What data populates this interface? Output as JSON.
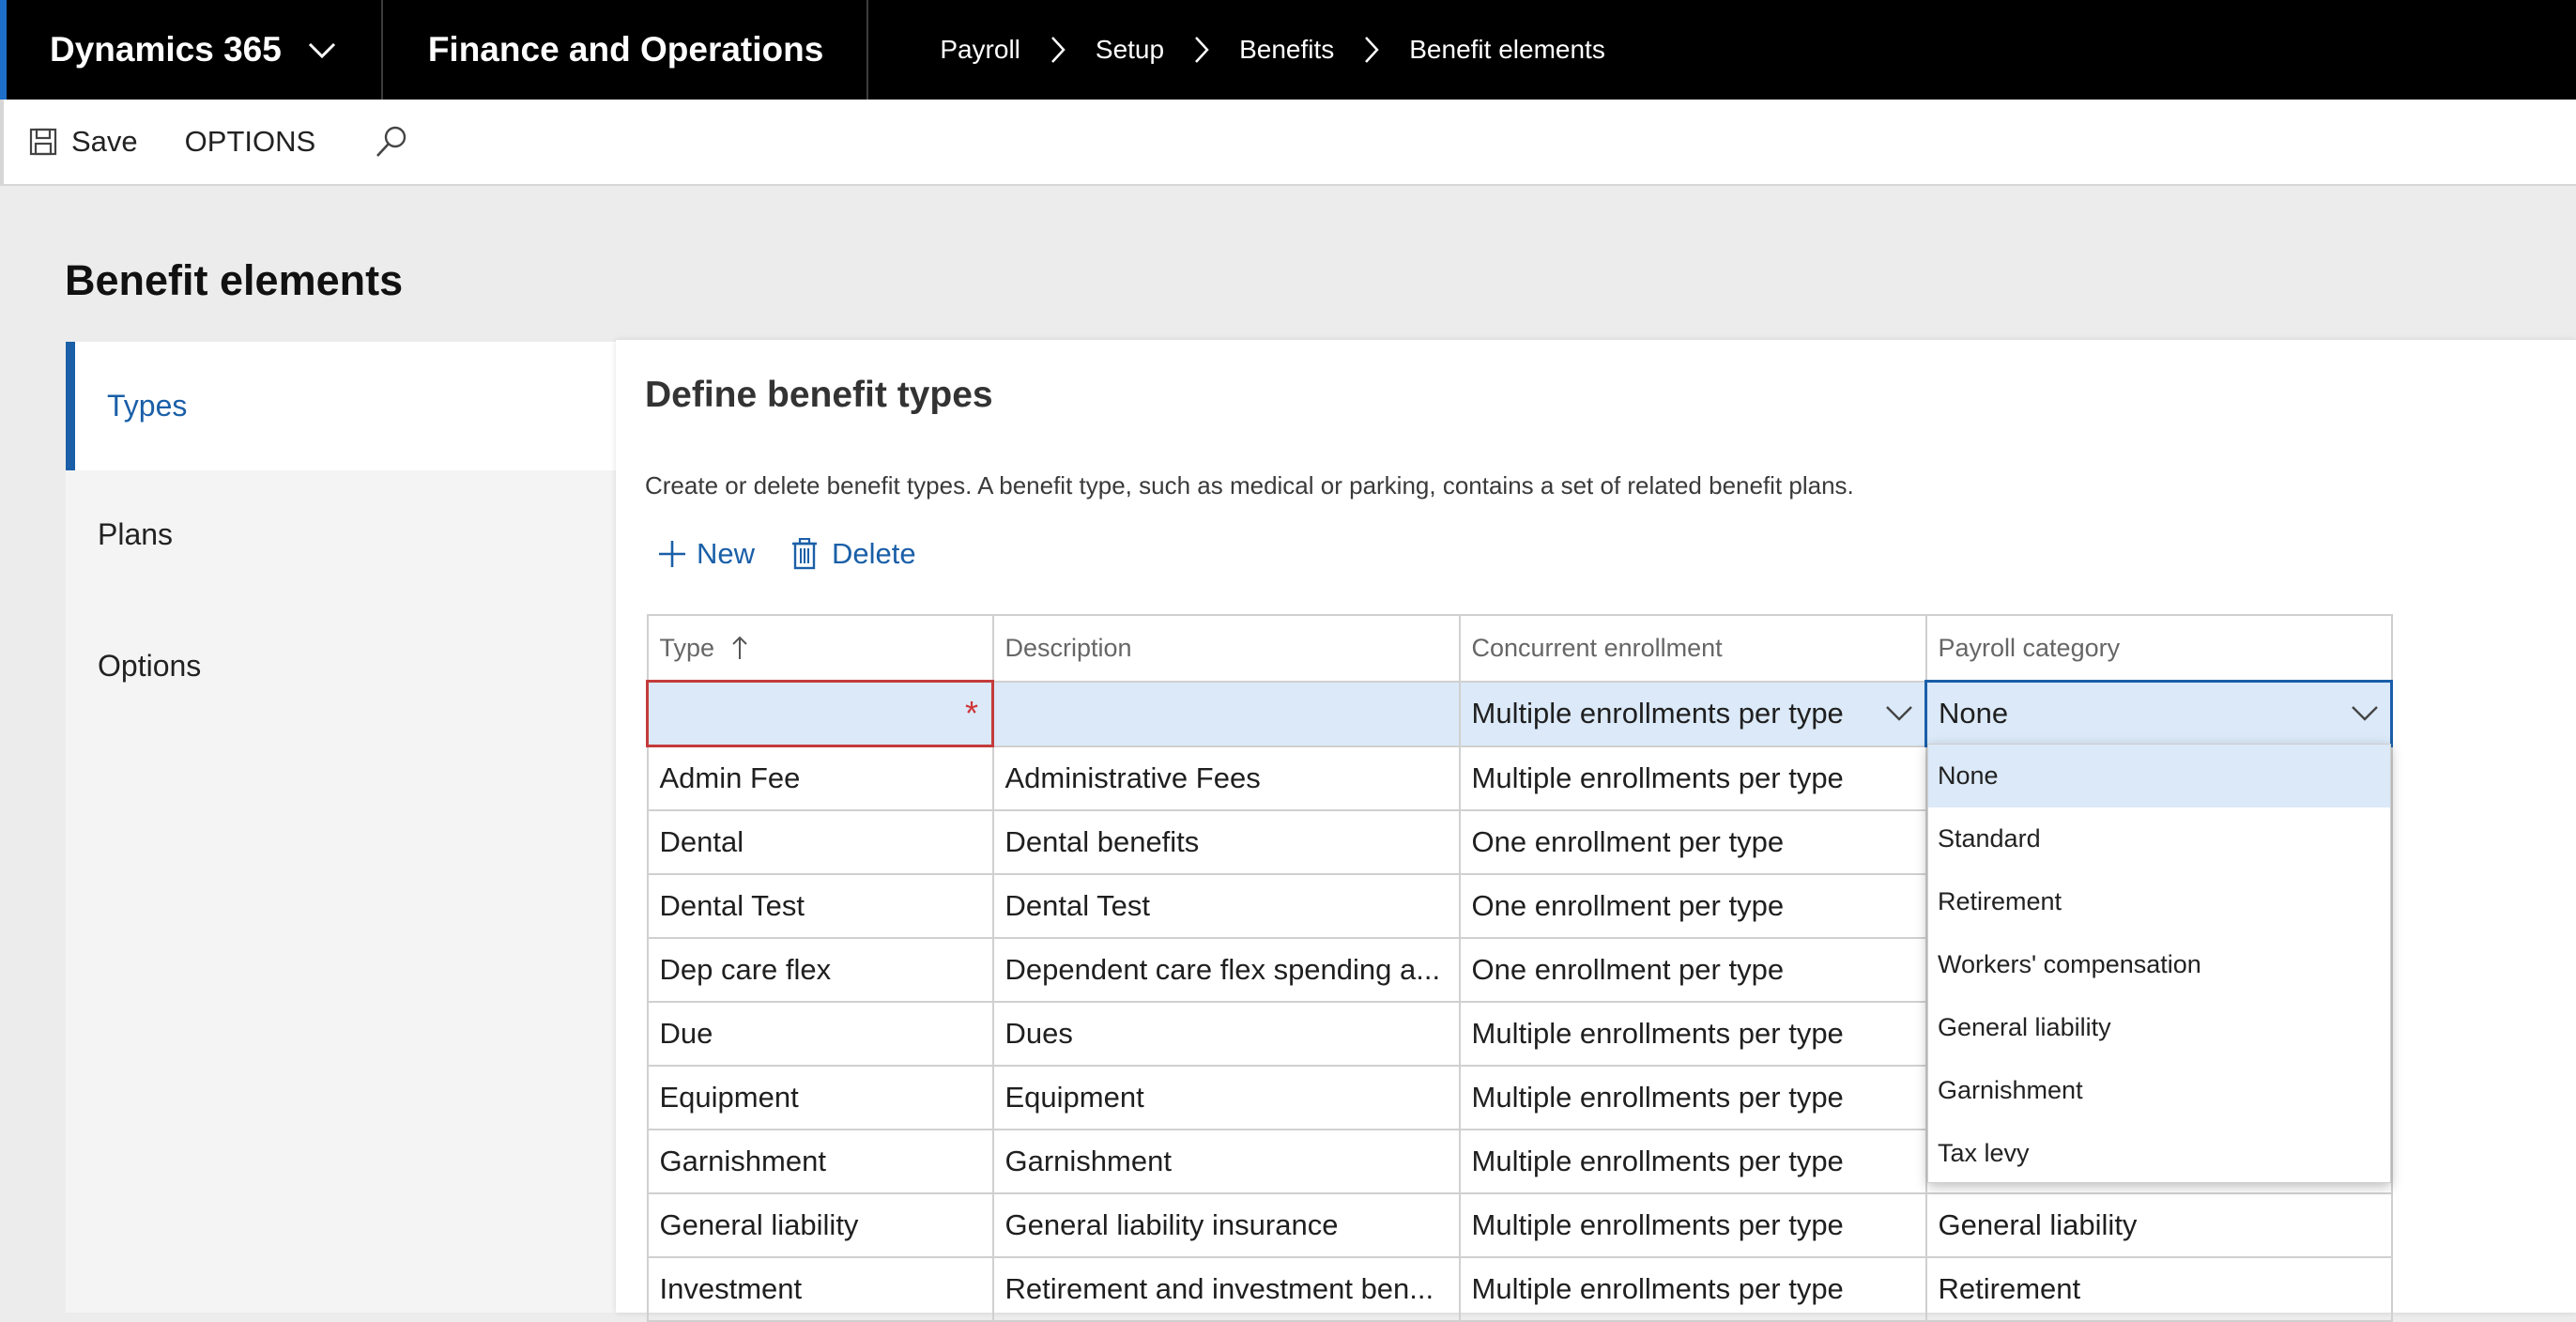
{
  "topbar": {
    "app": "Dynamics 365",
    "module": "Finance and Operations",
    "breadcrumbs": [
      "Payroll",
      "Setup",
      "Benefits",
      "Benefit elements"
    ]
  },
  "commandbar": {
    "save": "Save",
    "options": "OPTIONS"
  },
  "page": {
    "title": "Benefit elements"
  },
  "nav": {
    "items": [
      "Types",
      "Plans",
      "Options"
    ],
    "active": "Types"
  },
  "section": {
    "title": "Define benefit types",
    "description": "Create or delete benefit types. A benefit type, such as medical or parking, contains a set of related benefit plans.",
    "new_label": "New",
    "delete_label": "Delete"
  },
  "grid": {
    "columns": [
      "Type",
      "Description",
      "Concurrent enrollment",
      "Payroll category"
    ],
    "new_row": {
      "type": "",
      "description": "",
      "concurrent": "Multiple enrollments per type",
      "category": "None"
    },
    "rows": [
      {
        "type": "Admin Fee",
        "description": "Administrative Fees",
        "concurrent": "Multiple enrollments per type",
        "category": ""
      },
      {
        "type": "Dental",
        "description": "Dental benefits",
        "concurrent": "One enrollment per type",
        "category": ""
      },
      {
        "type": "Dental Test",
        "description": "Dental Test",
        "concurrent": "One enrollment per type",
        "category": ""
      },
      {
        "type": "Dep care flex",
        "description": "Dependent care flex spending a...",
        "concurrent": "One enrollment per type",
        "category": ""
      },
      {
        "type": "Due",
        "description": "Dues",
        "concurrent": "Multiple enrollments per type",
        "category": ""
      },
      {
        "type": "Equipment",
        "description": "Equipment",
        "concurrent": "Multiple enrollments per type",
        "category": ""
      },
      {
        "type": "Garnishment",
        "description": "Garnishment",
        "concurrent": "Multiple enrollments per type",
        "category": ""
      },
      {
        "type": "General liability",
        "description": "General liability insurance",
        "concurrent": "Multiple enrollments per type",
        "category": "General liability"
      },
      {
        "type": "Investment",
        "description": "Retirement and investment ben...",
        "concurrent": "Multiple enrollments per type",
        "category": "Retirement"
      }
    ]
  },
  "dropdown": {
    "options": [
      "None",
      "Standard",
      "Retirement",
      "Workers' compensation",
      "General liability",
      "Garnishment",
      "Tax levy"
    ],
    "selected": "None"
  },
  "colors": {
    "accent": "#1a5fa8",
    "selected_row": "#dbe9f8",
    "error": "#d13438",
    "topbar": "#000000"
  }
}
